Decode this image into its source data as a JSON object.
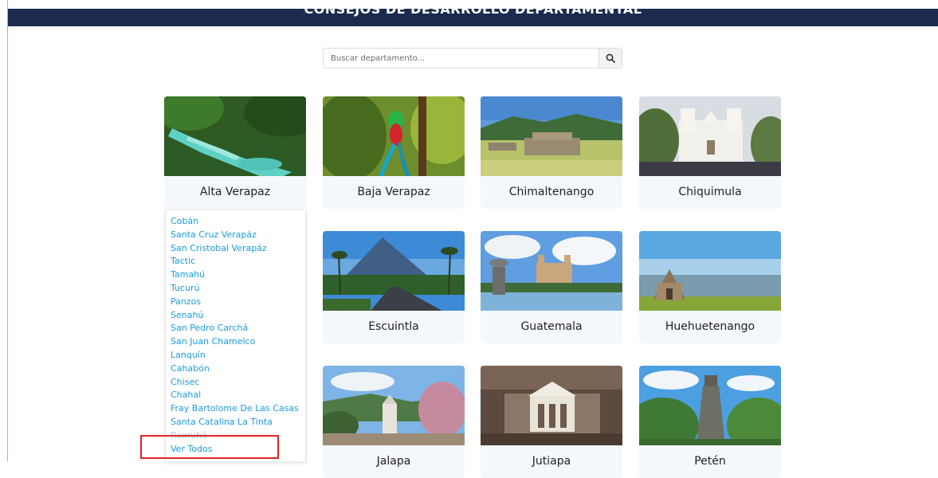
{
  "header": {
    "title": "CONSEJOS DE DESARROLLO DEPARTAMENTAL"
  },
  "search": {
    "placeholder": "Buscar departamento...",
    "icon": "search-icon"
  },
  "departments": [
    {
      "name": "Alta Verapaz"
    },
    {
      "name": "Baja Verapaz"
    },
    {
      "name": "Chimaltenango"
    },
    {
      "name": "Chiquimula"
    },
    {
      "name": "Escuintla"
    },
    {
      "name": "Guatemala"
    },
    {
      "name": "Huehuetenango"
    },
    {
      "name": "Jalapa"
    },
    {
      "name": "Jutiapa"
    },
    {
      "name": "Petén"
    }
  ],
  "dropdown": {
    "items": [
      "Cobán",
      "Santa Cruz Verapáz",
      "San Cristobal Verapáz",
      "Tactic",
      "Tamahú",
      "Tucurú",
      "Panzos",
      "Senahú",
      "San Pedro Carchá",
      "San Juan Chamelco",
      "Lanquín",
      "Cahabón",
      "Chisec",
      "Chahal",
      "Fray Bartolome De Las Casas",
      "Santa Catalina La Tinta",
      "Raxruhá"
    ],
    "view_all": "Ver Todos"
  },
  "colors": {
    "header_bg": "#1c2a4f",
    "link_blue": "#1b9bd8",
    "card_bg": "#f4f8fd",
    "highlight_red": "#e02424"
  }
}
